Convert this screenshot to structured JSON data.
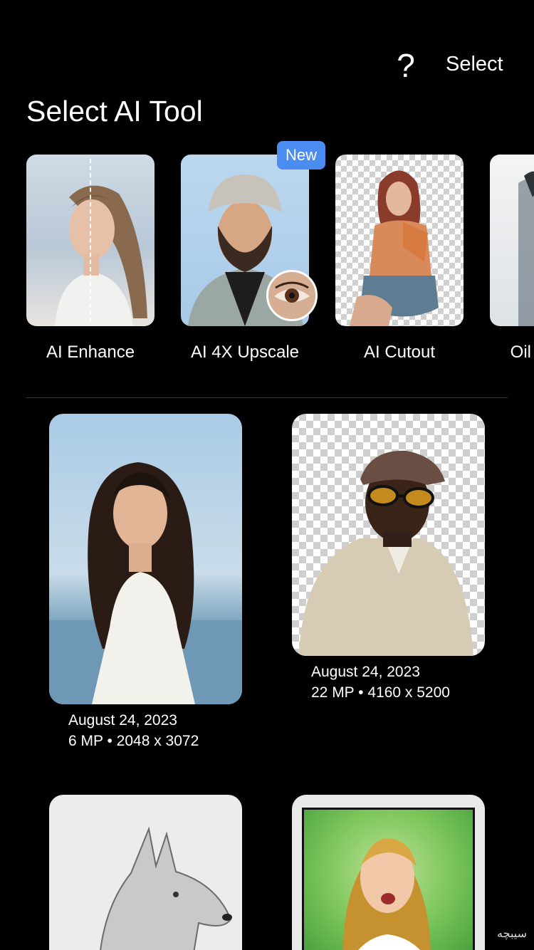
{
  "header": {
    "help_label": "?",
    "select_label": "Select"
  },
  "title": "Select AI Tool",
  "tools": [
    {
      "label": "AI Enhance"
    },
    {
      "label": "AI 4X Upscale",
      "badge": "New"
    },
    {
      "label": "AI Cutout"
    },
    {
      "label": "Oil"
    }
  ],
  "gallery": [
    {
      "date": "August 24, 2023",
      "info": "6 MP • 2048 x 3072"
    },
    {
      "date": "August 24, 2023",
      "info": "22 MP • 4160 x 5200"
    },
    {
      "date": "",
      "info": ""
    },
    {
      "date": "",
      "info": ""
    }
  ],
  "watermark": "سیبچه",
  "colors": {
    "background": "#000000",
    "text": "#ffffff",
    "badge": "#4a8cf0",
    "divider": "#3a3a3a"
  }
}
